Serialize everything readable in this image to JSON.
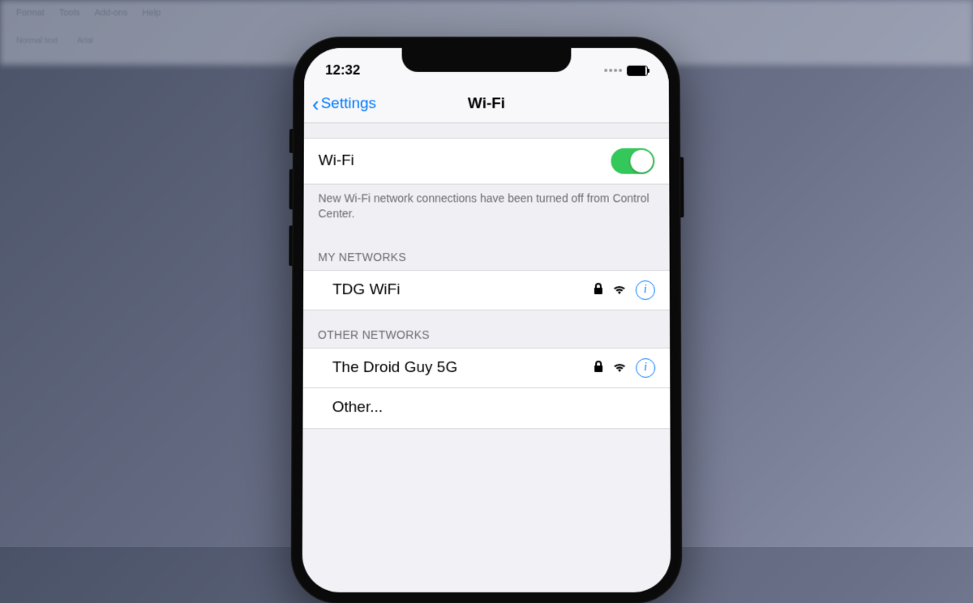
{
  "background": {
    "menu": [
      "Format",
      "Tools",
      "Add-ons",
      "Help"
    ],
    "toolbar": [
      "Normal text",
      "Arial"
    ]
  },
  "status": {
    "time": "12:32"
  },
  "nav": {
    "back_label": "Settings",
    "title": "Wi-Fi"
  },
  "wifi_toggle": {
    "label": "Wi-Fi",
    "footer": "New Wi-Fi network connections have been turned off from Control Center."
  },
  "sections": {
    "my_networks": {
      "header": "MY NETWORKS",
      "items": [
        {
          "name": "TDG WiFi",
          "locked": true
        }
      ]
    },
    "other_networks": {
      "header": "OTHER NETWORKS",
      "items": [
        {
          "name": "The Droid Guy 5G",
          "locked": true
        }
      ],
      "other_label": "Other..."
    }
  }
}
